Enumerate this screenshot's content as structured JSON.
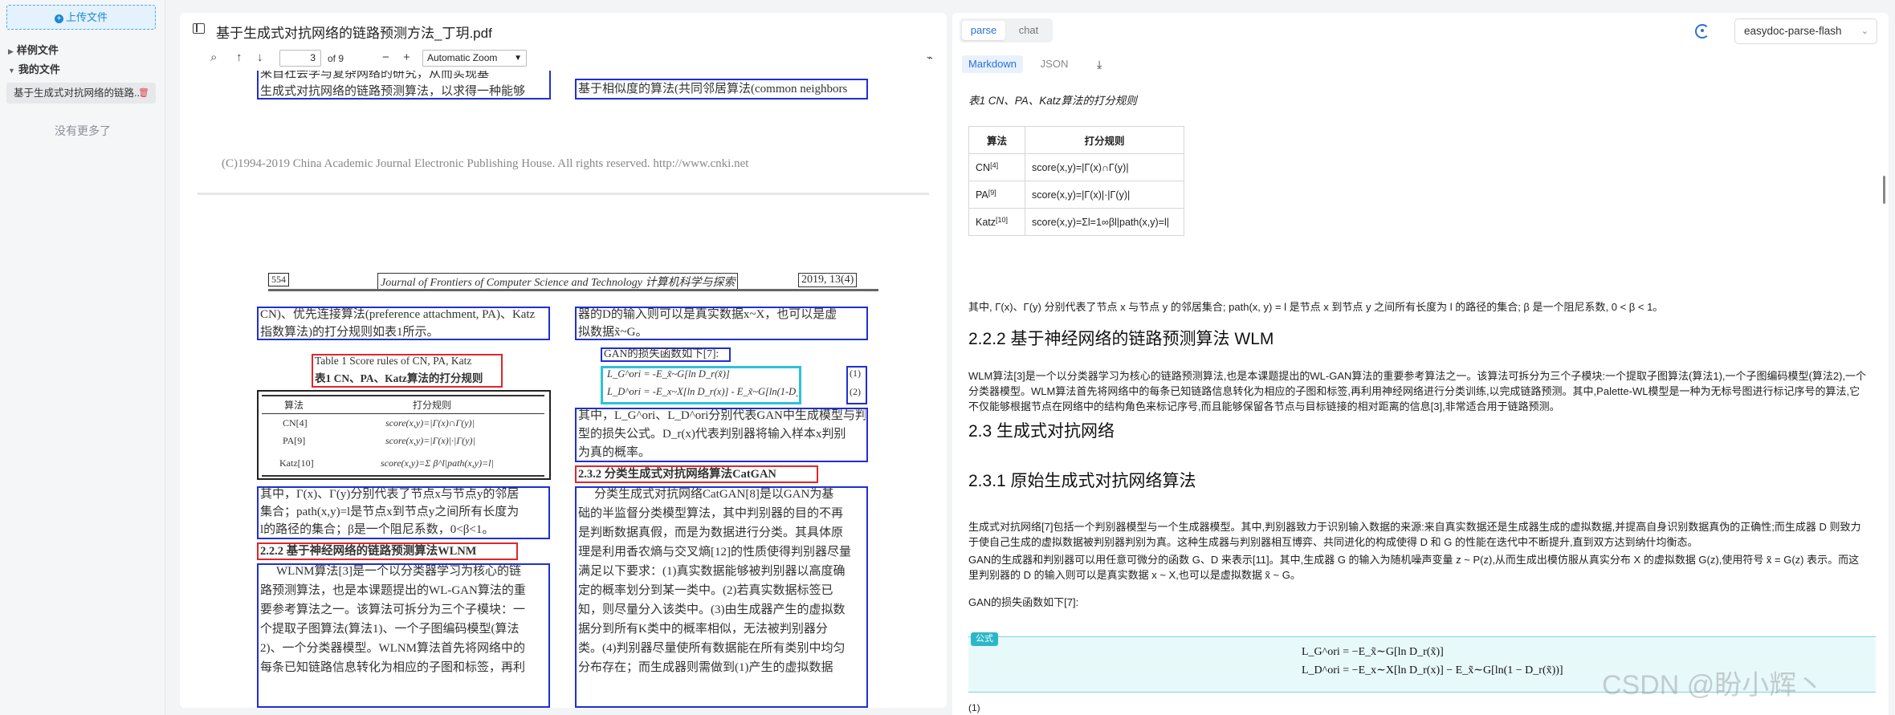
{
  "sidebar": {
    "upload_label": "上传文件",
    "sample_files": "样例文件",
    "my_files": "我的文件",
    "file_name": "基于生成式对抗网络的链路...",
    "no_more": "没有更多了"
  },
  "pdf": {
    "title": "基于生成式对抗网络的链路预测方法_丁玥.pdf",
    "page": "3",
    "page_of": "of 9",
    "zoom": "Automatic Zoom",
    "copyright": "(C)1994-2019 China Academic Journal Electronic Publishing House. All rights reserved.    http://www.cnki.net",
    "running_head_left": "554",
    "running_head_center": "Journal of Frontiers of Computer Science and Technology   计算机科学与探索",
    "running_head_right": "2019, 13(4)",
    "top_left_lines": [
      "来自社会学与复杂网络的研究，从而实现基",
      "生成式对抗网络的链路预测算法，以求得一种能够"
    ],
    "top_right_line": "基于相似度的算法(共同邻居算法(common neighbors",
    "col1_lines": [
      "CN)、优先连接算法(preference attachment, PA)、Katz",
      "指数算法)的打分规则如表1所示。"
    ],
    "table_cap_en": "Table 1    Score rules of CN, PA, Katz",
    "table_cap_zh": "表1    CN、PA、Katz算法的打分规则",
    "table_head": [
      "算法",
      "打分规则"
    ],
    "table_rows": [
      [
        "CN[4]",
        "score(x,y)=|Γ(x)∩Γ(y)|"
      ],
      [
        "PA[9]",
        "score(x,y)=|Γ(x)|·|Γ(y)|"
      ],
      [
        "Katz[10]",
        "score(x,y)=Σ β^l|path(x,y)=l|"
      ]
    ],
    "col1_para": [
      "其中，Γ(x)、Γ(y)分别代表了节点x与节点y的邻居",
      "集合；path(x,y)=l是节点x到节点y之间所有长度为",
      "l的路径的集合；β是一个阻尼系数，0<β<1。"
    ],
    "heading_222": "2.2.2    基于神经网络的链路预测算法WLNM",
    "col1_wlnm": [
      "WLNM算法[3]是一个以分类器学习为核心的链",
      "路预测算法，也是本课题提出的WL-GAN算法的重",
      "要参考算法之一。该算法可拆分为三个子模块：一",
      "个提取子图算法(算法1)、一个子图编码模型(算法",
      "2)、一个分类器模型。WLNM算法首先将网络中的",
      "每条已知链路信息转化为相应的子图和标签，再利"
    ],
    "col2_top": [
      "器的D的输入则可以是真实数据x~X，也可以是虚",
      "拟数据x̃~G。"
    ],
    "gan_loss_label": "GAN的损失函数如下[7]:",
    "gan_formula_1": "L_G^ori = -E_x̃~G[ln D_r(x̃)]",
    "gan_formula_2": "L_D^ori = -E_x~X[ln D_r(x)] - E_x̃~G[ln(1-D_r(x̃))]",
    "eq_num_1": "(1)",
    "eq_num_2": "(2)",
    "col2_mid": [
      "其中，L_G^ori、L_D^ori分别代表GAN中生成模型与判别模",
      "型的损失公式。D_r(x)代表判别器将输入样本x判别",
      "为真的概率。"
    ],
    "heading_232": "2.3.2    分类生成式对抗网络算法CatGAN",
    "col2_catgan": [
      "分类生成式对抗网络CatGAN[8]是以GAN为基",
      "础的半监督分类模型算法，其中判别器的目的不再",
      "是判断数据真假，而是为数据进行分类。其具体原",
      "理是利用香农熵与交叉熵[12]的性质使得判别器尽量",
      "满足以下要求：(1)真实数据能够被判别器以高度确",
      "定的概率划分到某一类中。(2)若真实数据标签已",
      "知，则尽量分入该类中。(3)由生成器产生的虚拟数",
      "据分到所有K类中的概率相似，无法被判别器分",
      "类。(4)判别器尽量使所有数据能在所有类别中均匀",
      "分布存在；而生成器则需做到(1)产生的虚拟数据"
    ]
  },
  "right": {
    "tab_parse": "parse",
    "tab_chat": "chat",
    "model": "easydoc-parse-flash",
    "fmt_markdown": "Markdown",
    "fmt_json": "JSON",
    "caption": "表1 CN、PA、Katz算法的打分规则",
    "table_head": [
      "算法",
      "打分规则"
    ],
    "table_rows": [
      {
        "name": "CN",
        "ref": "[4]",
        "rule": "score(x,y)=|Γ(x)∩Γ(y)|"
      },
      {
        "name": "PA",
        "ref": "[9]",
        "rule": "score(x,y)=|Γ(x)|·|Γ(y)|"
      },
      {
        "name": "Katz",
        "ref": "[10]",
        "rule": "score(x,y)=Σl=1∞βl|path(x,y)=l|"
      }
    ],
    "para1": "其中, Γ(x)、Γ(y) 分别代表了节点 x 与节点 y 的邻居集合; path(x, y) = l 是节点 x 到节点 y 之间所有长度为 l 的路径的集合; β 是一个阻尼系数, 0 < β < 1。",
    "h_222": "2.2.2 基于神经网络的链路预测算法 WLM",
    "para2": "WLM算法[3]是一个以分类器学习为核心的链路预测算法,也是本课题提出的WL-GAN算法的重要参考算法之一。该算法可拆分为三个子模块:一个提取子图算法(算法1),一个子图编码模型(算法2),一个分类器模型。WLM算法首先将网络中的每条已知链路信息转化为相应的子图和标签,再利用神经网络进行分类训练,以完成链路预测。其中,Palette-WL模型是一种为无标号图进行标记序号的算法,它不仅能够根据节点在网络中的结构角色来标记序号,而且能够保留各节点与目标链接的相对距离的信息[3],非常适合用于链路预测。",
    "h_23": "2.3 生成式对抗网络",
    "h_231": "2.3.1 原始生成式对抗网络算法",
    "para3": "生成式对抗网络[7]包括一个判别器模型与一个生成器模型。其中,判别器致力于识别输入数据的来源:来自真实数据还是生成器生成的虚拟数据,并提高自身识别数据真伪的正确性;而生成器 D 则致力于使自己生成的虚拟数据被判别器判别为真。这种生成器与判别器相互博弈、共同进化的构成使得 D 和 G 的性能在迭代中不断提升,直到双方达到纳什均衡态。",
    "para4": "GAN的生成器和判别器可以用任意可微分的函数 G、D 来表示[11]。其中,生成器 G 的输入为随机噪声变量 z ~ P(z),从而生成出模仿服从真实分布 X 的虚拟数据 G(z),使用符号 x̃ = G(z) 表示。而这里判别器的 D 的输入则可以是真实数据 x ~ X,也可以是虚拟数据 x̃ ~ G。",
    "para5": "GAN的损失函数如下[7]:",
    "formula_tag": "公式",
    "formula_1": "L_G^ori = −E_x̃∼G[ln D_r(x̃)]",
    "formula_2": "L_D^ori = −E_x∼X[ln D_r(x)] − E_x̃∼G[ln(1 − D_r(x̃))]",
    "after_formula": "(1)"
  },
  "watermark": "CSDN @盼小辉丶"
}
